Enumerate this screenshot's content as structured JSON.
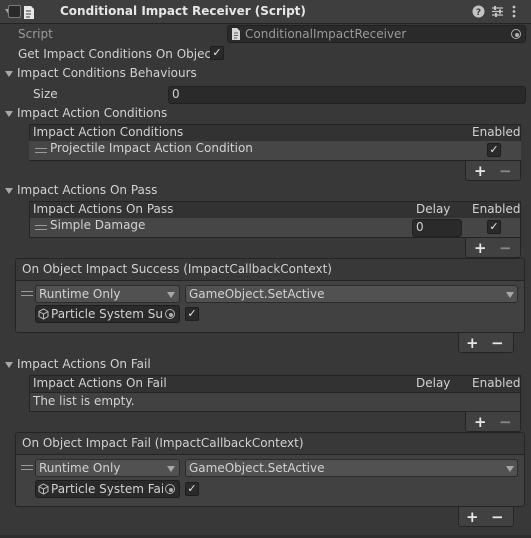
{
  "component": {
    "title": "Conditional Impact Receiver (Script)",
    "script_label": "Script",
    "script_value": "ConditionalImpactReceiver",
    "get_conditions_label": "Get Impact Conditions On Object",
    "get_conditions_checked": true
  },
  "conditions_behaviours": {
    "label": "Impact Conditions Behaviours",
    "size_label": "Size",
    "size_value": "0"
  },
  "action_conditions": {
    "label": "Impact Action Conditions",
    "col_name": "Impact Action Conditions",
    "col_enabled": "Enabled",
    "rows": [
      {
        "name": "Projectile Impact Action Condition",
        "enabled": true
      }
    ],
    "add": "+",
    "remove": "−"
  },
  "actions_on_pass": {
    "label": "Impact Actions On Pass",
    "col_name": "Impact Actions On Pass",
    "col_delay": "Delay",
    "col_enabled": "Enabled",
    "rows": [
      {
        "name": "Simple Damage",
        "delay": "0",
        "enabled": true
      }
    ],
    "add": "+",
    "remove": "−"
  },
  "on_success": {
    "title": "On Object Impact Success (ImpactCallbackContext)",
    "mode": "Runtime Only",
    "function": "GameObject.SetActive",
    "target": "Particle System Suc",
    "arg_checked": true,
    "add": "+",
    "remove": "−"
  },
  "actions_on_fail": {
    "label": "Impact Actions On Fail",
    "col_name": "Impact Actions On Fail",
    "col_delay": "Delay",
    "col_enabled": "Enabled",
    "empty_text": "The list is empty.",
    "add": "+",
    "remove": "−"
  },
  "on_fail": {
    "title": "On Object Impact Fail (ImpactCallbackContext)",
    "mode": "Runtime Only",
    "function": "GameObject.SetActive",
    "target": "Particle System Fail",
    "arg_checked": true,
    "add": "+",
    "remove": "−"
  },
  "icons": {
    "foldout": "triangle-down",
    "help": "question-icon",
    "presets": "sliders-icon",
    "menu": "kebab-icon",
    "script": "script-icon",
    "target": "object-picker-icon",
    "gameobject": "cube-icon"
  },
  "check_glyph": "✓"
}
